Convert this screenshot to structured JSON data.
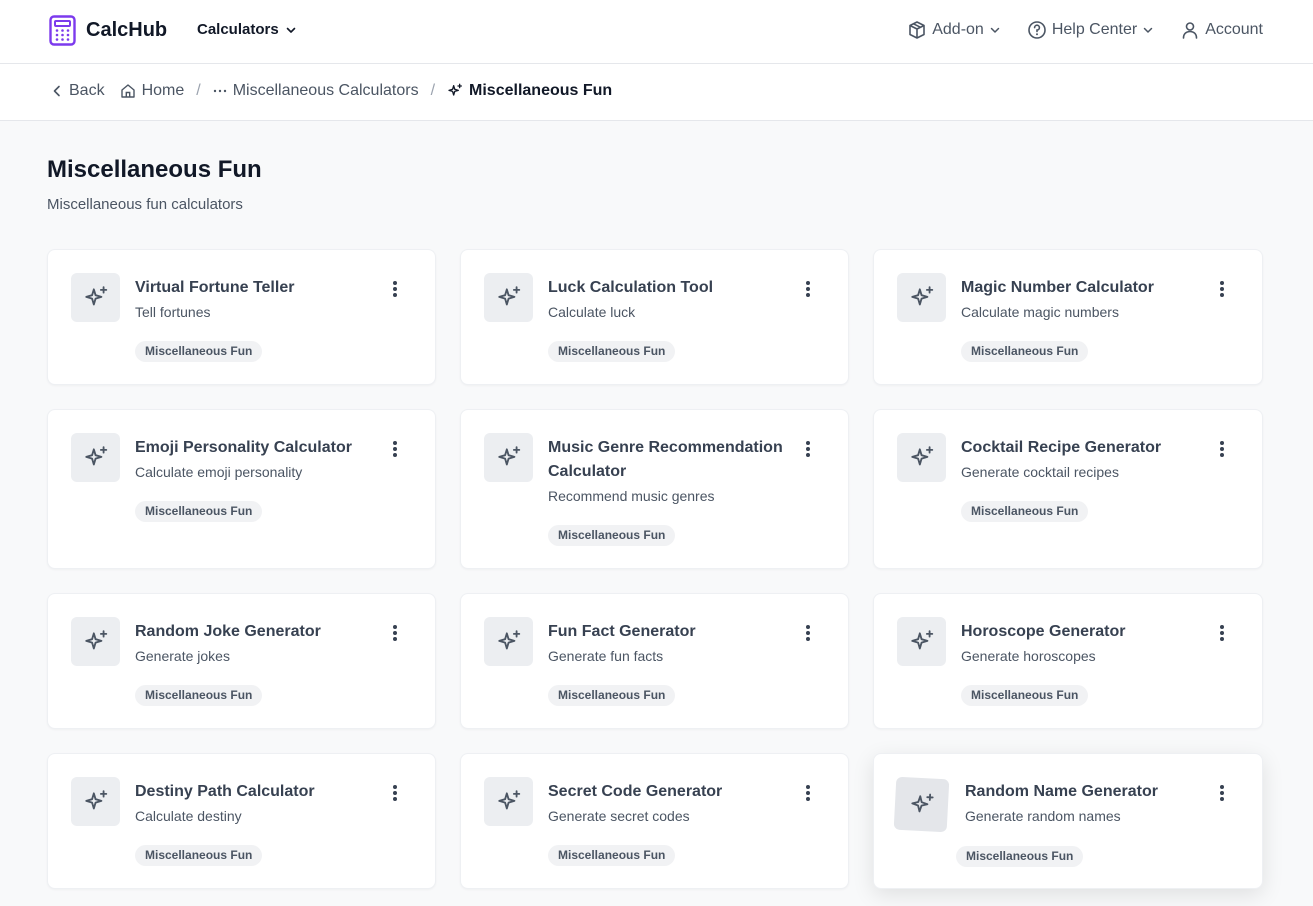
{
  "header": {
    "brand": "CalcHub",
    "nav_calculators": "Calculators",
    "addon": "Add-on",
    "help": "Help Center",
    "account": "Account",
    "accent_color": "#7c3aed"
  },
  "breadcrumb": {
    "back": "Back",
    "home": "Home",
    "parent": "Miscellaneous Calculators",
    "current": "Miscellaneous Fun",
    "separator": "/"
  },
  "page": {
    "title": "Miscellaneous Fun",
    "subtitle": "Miscellaneous fun calculators"
  },
  "cards": [
    {
      "title": "Virtual Fortune Teller",
      "desc": "Tell fortunes",
      "tag": "Miscellaneous Fun",
      "icon": "sparkles-icon"
    },
    {
      "title": "Luck Calculation Tool",
      "desc": "Calculate luck",
      "tag": "Miscellaneous Fun",
      "icon": "sparkles-icon"
    },
    {
      "title": "Magic Number Calculator",
      "desc": "Calculate magic numbers",
      "tag": "Miscellaneous Fun",
      "icon": "sparkles-icon"
    },
    {
      "title": "Emoji Personality Calculator",
      "desc": "Calculate emoji personality",
      "tag": "Miscellaneous Fun",
      "icon": "sparkles-icon"
    },
    {
      "title": "Music Genre Recommendation Calculator",
      "desc": "Recommend music genres",
      "tag": "Miscellaneous Fun",
      "icon": "sparkles-icon"
    },
    {
      "title": "Cocktail Recipe Generator",
      "desc": "Generate cocktail recipes",
      "tag": "Miscellaneous Fun",
      "icon": "sparkles-icon"
    },
    {
      "title": "Random Joke Generator",
      "desc": "Generate jokes",
      "tag": "Miscellaneous Fun",
      "icon": "sparkles-icon"
    },
    {
      "title": "Fun Fact Generator",
      "desc": "Generate fun facts",
      "tag": "Miscellaneous Fun",
      "icon": "sparkles-icon"
    },
    {
      "title": "Horoscope Generator",
      "desc": "Generate horoscopes",
      "tag": "Miscellaneous Fun",
      "icon": "sparkles-icon"
    },
    {
      "title": "Destiny Path Calculator",
      "desc": "Calculate destiny",
      "tag": "Miscellaneous Fun",
      "icon": "sparkles-icon"
    },
    {
      "title": "Secret Code Generator",
      "desc": "Generate secret codes",
      "tag": "Miscellaneous Fun",
      "icon": "sparkles-icon"
    },
    {
      "title": "Random Name Generator",
      "desc": "Generate random names",
      "tag": "Miscellaneous Fun",
      "icon": "sparkles-icon"
    }
  ]
}
